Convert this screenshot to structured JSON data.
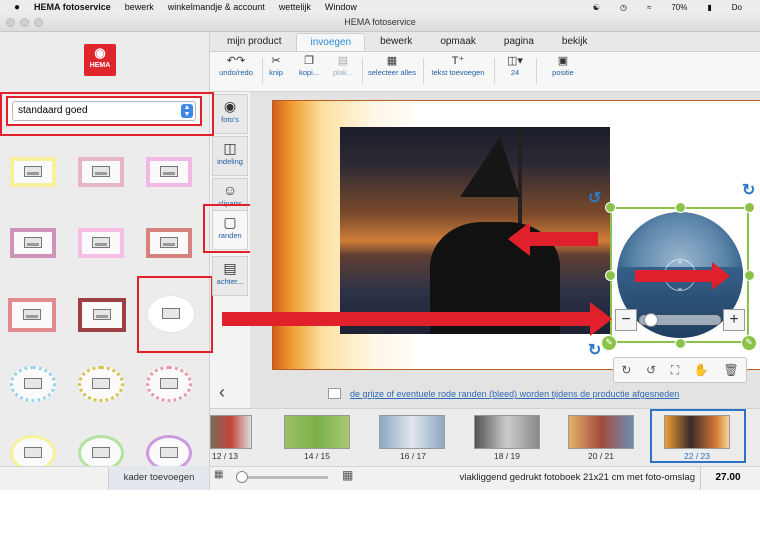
{
  "macbar": {
    "app": "HEMA fotoservice",
    "menus": [
      "bewerk",
      "winkelmandje & account",
      "wettelijk",
      "Window"
    ],
    "battery": "70%",
    "clock": "Do"
  },
  "window": {
    "title": "HEMA fotoservice"
  },
  "logo": {
    "text": "HEMA"
  },
  "sidebar": {
    "frame_style": "standaard goed",
    "add_frame_label": "kader toevoegen"
  },
  "tabs": [
    {
      "label": "mijn product"
    },
    {
      "label": "invoegen"
    },
    {
      "label": "bewerk"
    },
    {
      "label": "opmaak"
    },
    {
      "label": "pagina"
    },
    {
      "label": "bekijk"
    }
  ],
  "toolbar": {
    "undo_redo": "undo/redo",
    "cut": "knip",
    "copy": "kopi...",
    "paste": "plak...",
    "select_all": "selecteer alles",
    "add_text": "tekst toevoegen",
    "size": "24",
    "position": "positie"
  },
  "side_tools": [
    {
      "label": "foto's"
    },
    {
      "label": "indeling"
    },
    {
      "label": "cliparts"
    },
    {
      "label": "randen"
    },
    {
      "label": "achter..."
    }
  ],
  "canvas": {
    "bleed_notice": "de grijze of eventuele rode randen (bleed) worden tijdens de productie afgesneden"
  },
  "filmstrip": [
    {
      "label": "12 / 13"
    },
    {
      "label": "14 / 15"
    },
    {
      "label": "16 / 17"
    },
    {
      "label": "18 / 19"
    },
    {
      "label": "20 / 21"
    },
    {
      "label": "22 / 23"
    }
  ],
  "status": {
    "product": "vlakliggend gedrukt fotoboek 21x21 cm met foto-omslag",
    "price": "27.00"
  },
  "colors": {
    "accent": "#2b8bd6",
    "annotation": "#e0202a",
    "selection": "#8bc34a",
    "hema": "#e0262d"
  }
}
